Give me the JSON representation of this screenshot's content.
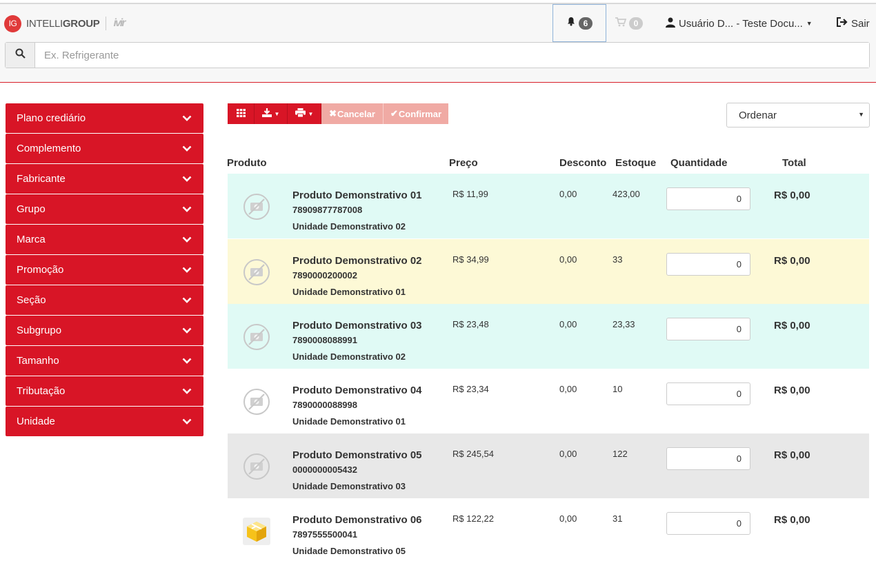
{
  "header": {
    "logo_badge": "IG",
    "logo_light": "INTELLI",
    "logo_bold": "GROUP",
    "logo_mark": "ivir",
    "notifications_count": "6",
    "cart_count": "0",
    "user_label": "Usuário D... - Teste Docu...",
    "logout_label": "Sair"
  },
  "search": {
    "placeholder": "Ex. Refrigerante",
    "value": ""
  },
  "sidebar": {
    "items": [
      {
        "label": "Plano crediário"
      },
      {
        "label": "Complemento"
      },
      {
        "label": "Fabricante"
      },
      {
        "label": "Grupo"
      },
      {
        "label": "Marca"
      },
      {
        "label": "Promoção"
      },
      {
        "label": "Seção"
      },
      {
        "label": "Subgrupo"
      },
      {
        "label": "Tamanho"
      },
      {
        "label": "Tributação"
      },
      {
        "label": "Unidade"
      }
    ]
  },
  "toolbar": {
    "cancel_label": "Cancelar",
    "confirm_label": "Confirmar",
    "order_label": "Ordenar"
  },
  "table": {
    "columns": {
      "product": "Produto",
      "price": "Preço",
      "discount": "Desconto",
      "stock": "Estoque",
      "quantity": "Quantidade",
      "total": "Total"
    },
    "rows": [
      {
        "name": "Produto Demonstrativo 01",
        "code": "78909877787008",
        "unit": "Unidade Demonstrativo 02",
        "price": "R$ 11,99",
        "discount": "0,00",
        "stock": "423,00",
        "quantity": "0",
        "total": "R$ 0,00",
        "bg": "#e0faf5",
        "image": "no-image-icon"
      },
      {
        "name": "Produto Demonstrativo 02",
        "code": "7890000200002",
        "unit": "Unidade Demonstrativo 01",
        "price": "R$ 34,99",
        "discount": "0,00",
        "stock": "33",
        "quantity": "0",
        "total": "R$ 0,00",
        "bg": "#fdf9d6",
        "image": "no-image-icon"
      },
      {
        "name": "Produto Demonstrativo 03",
        "code": "7890008088991",
        "unit": "Unidade Demonstrativo 02",
        "price": "R$ 23,48",
        "discount": "0,00",
        "stock": "23,33",
        "quantity": "0",
        "total": "R$ 0,00",
        "bg": "#e0faf5",
        "image": "no-image-icon"
      },
      {
        "name": "Produto Demonstrativo 04",
        "code": "7890000088998",
        "unit": "Unidade Demonstrativo 01",
        "price": "R$ 23,34",
        "discount": "0,00",
        "stock": "10",
        "quantity": "0",
        "total": "R$ 0,00",
        "bg": "#ffffff",
        "image": "no-image-icon"
      },
      {
        "name": "Produto Demonstrativo 05",
        "code": "0000000005432",
        "unit": "Unidade Demonstrativo 03",
        "price": "R$ 245,54",
        "discount": "0,00",
        "stock": "122",
        "quantity": "0",
        "total": "R$ 0,00",
        "bg": "#e8e8e8",
        "image": "no-image-icon"
      },
      {
        "name": "Produto Demonstrativo 06",
        "code": "7897555500041",
        "unit": "Unidade Demonstrativo 05",
        "price": "R$ 122,22",
        "discount": "0,00",
        "stock": "31",
        "quantity": "0",
        "total": "R$ 0,00",
        "bg": "#ffffff",
        "image": "product-box-icon"
      }
    ]
  },
  "colors": {
    "brand_red": "#d81526",
    "disabled_red": "#f0aaa4"
  }
}
